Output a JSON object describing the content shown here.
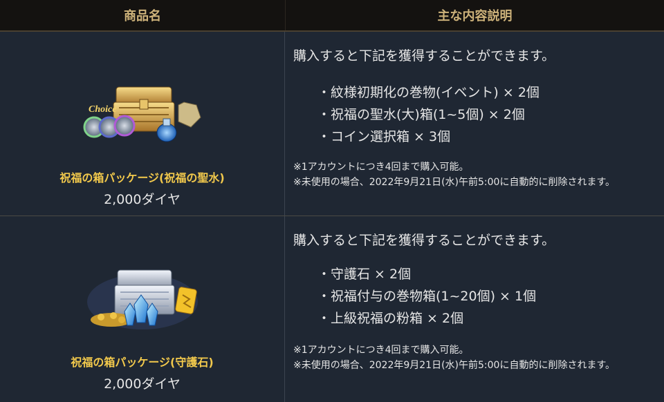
{
  "header": {
    "col_product": "商品名",
    "col_description": "主な内容説明"
  },
  "products": [
    {
      "name": "祝福の箱パッケージ(祝福の聖水)",
      "price": "2,000ダイヤ",
      "image_icon": "blessing-box-holy-water-icon",
      "intro": "購入すると下記を獲得することができます。",
      "items": [
        "・紋様初期化の巻物(イベント) × 2個",
        "・祝福の聖水(大)箱(1~5個) × 2個",
        "・コイン選択箱 × 3個"
      ],
      "notes": [
        "※1アカウントにつき4回まで購入可能。",
        "※未使用の場合、2022年9月21日(水)午前5:00に自動的に削除されます。"
      ]
    },
    {
      "name": "祝福の箱パッケージ(守護石)",
      "price": "2,000ダイヤ",
      "image_icon": "blessing-box-guardian-stone-icon",
      "intro": "購入すると下記を獲得することができます。",
      "items": [
        "・守護石 × 2個",
        "・祝福付与の巻物箱(1~20個) × 1個",
        "・上級祝福の粉箱 × 2個"
      ],
      "notes": [
        "※1アカウントにつき4回まで購入可能。",
        "※未使用の場合、2022年9月21日(水)午前5:00に自動的に削除されます。"
      ]
    }
  ],
  "colors": {
    "header_bg": "#141210",
    "header_text": "#cdb27a",
    "body_bg": "#1f2733",
    "product_name": "#f2c94c"
  }
}
